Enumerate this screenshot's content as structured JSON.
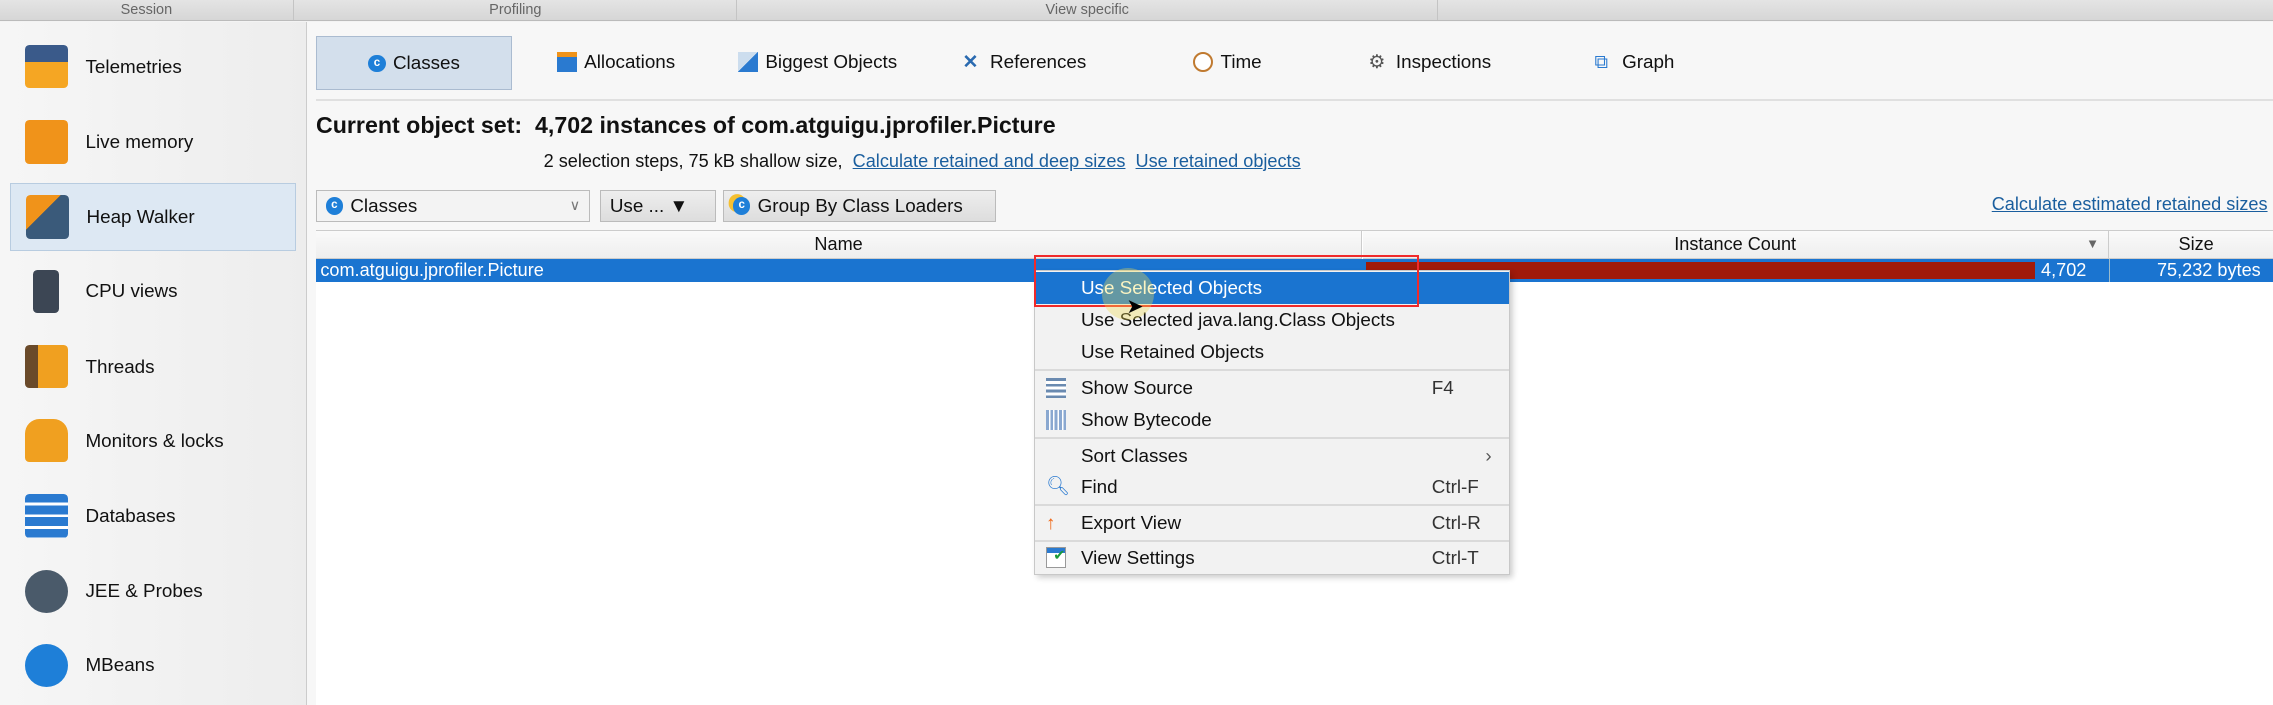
{
  "header": {
    "sections": [
      "Session",
      "Profiling",
      "View specific"
    ]
  },
  "sidebar": {
    "items": [
      {
        "label": "Telemetries",
        "icon": "telemetries-icon"
      },
      {
        "label": "Live memory",
        "icon": "live-memory-icon"
      },
      {
        "label": "Heap Walker",
        "icon": "heap-walker-icon",
        "selected": true
      },
      {
        "label": "CPU views",
        "icon": "cpu-icon"
      },
      {
        "label": "Threads",
        "icon": "threads-icon"
      },
      {
        "label": "Monitors & locks",
        "icon": "lock-icon"
      },
      {
        "label": "Databases",
        "icon": "database-icon"
      },
      {
        "label": "JEE & Probes",
        "icon": "gauge-icon"
      },
      {
        "label": "MBeans",
        "icon": "globe-icon"
      }
    ]
  },
  "tabs": [
    {
      "label": "Classes",
      "selected": true
    },
    {
      "label": "Allocations"
    },
    {
      "label": "Biggest Objects"
    },
    {
      "label": "References"
    },
    {
      "label": "Time"
    },
    {
      "label": "Inspections"
    },
    {
      "label": "Graph"
    }
  ],
  "main": {
    "title": "Current object set:  4,702 instances of com.atguigu.jprofiler.Picture",
    "subtitle": "2 selection steps, 75 kB shallow size,",
    "link_retained": "Calculate retained and deep sizes",
    "link_use_retained": "Use retained objects",
    "view_select": "Classes",
    "use_button": "Use ... ▼",
    "group_button": "Group By Class Loaders",
    "link_estimated": "Calculate estimated retained sizes"
  },
  "table": {
    "columns": [
      "Name",
      "Instance Count",
      "Size"
    ],
    "rows": [
      {
        "name": "com.atguigu.jprofiler.Picture",
        "count": "4,702",
        "count_fraction": 1.0,
        "size": "75,232 bytes"
      }
    ]
  },
  "context_menu": {
    "items": [
      {
        "label": "Use Selected Objects",
        "highlighted": true
      },
      {
        "label": "Use Selected java.lang.Class Objects"
      },
      {
        "label": "Use Retained Objects"
      },
      {
        "label": "Show Source",
        "shortcut": "F4"
      },
      {
        "label": "Show Bytecode"
      },
      {
        "label": "Sort Classes",
        "submenu": "›"
      },
      {
        "label": "Find",
        "shortcut": "Ctrl-F"
      },
      {
        "label": "Export View",
        "shortcut": "Ctrl-R"
      },
      {
        "label": "View Settings",
        "shortcut": "Ctrl-T"
      }
    ]
  },
  "colors": {
    "selection": "#1a74d0",
    "bar": "#a01a0a",
    "highlight_box": "#f02a2a"
  }
}
